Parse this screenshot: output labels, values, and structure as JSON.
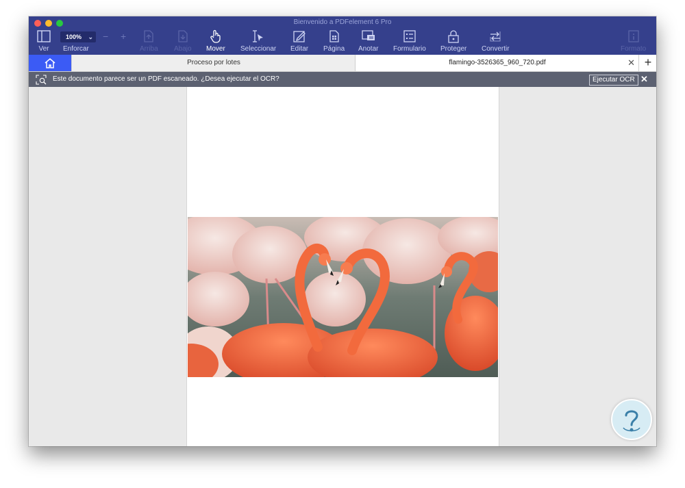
{
  "window": {
    "title": "Bienvenido a PDFelement 6 Pro"
  },
  "toolbar": {
    "view_label": "Ver",
    "zoom_value": "100%",
    "zoom_label": "Enforcar",
    "zoom_out": "−",
    "zoom_in": "+",
    "up_label": "Arriba",
    "down_label": "Abajo",
    "move_label": "Mover",
    "select_label": "Seleccionar",
    "edit_label": "Editar",
    "page_label": "Página",
    "annotate_label": "Anotar",
    "form_label": "Formulario",
    "protect_label": "Proteger",
    "convert_label": "Convertir",
    "format_label": "Formato"
  },
  "tabs": {
    "batch": "Proceso por lotes",
    "document": "flamingo-3526365_960_720.pdf",
    "close": "✕",
    "new": "+"
  },
  "ocr_bar": {
    "message": "Este documento parece ser un PDF escaneado. ¿Desea ejecutar el OCR?",
    "button": "Ejecutar OCR",
    "close": "✕"
  },
  "colors": {
    "toolbar_bg": "#35408c",
    "home_tab": "#3b5bf5",
    "ocr_bar": "#5c6171"
  }
}
